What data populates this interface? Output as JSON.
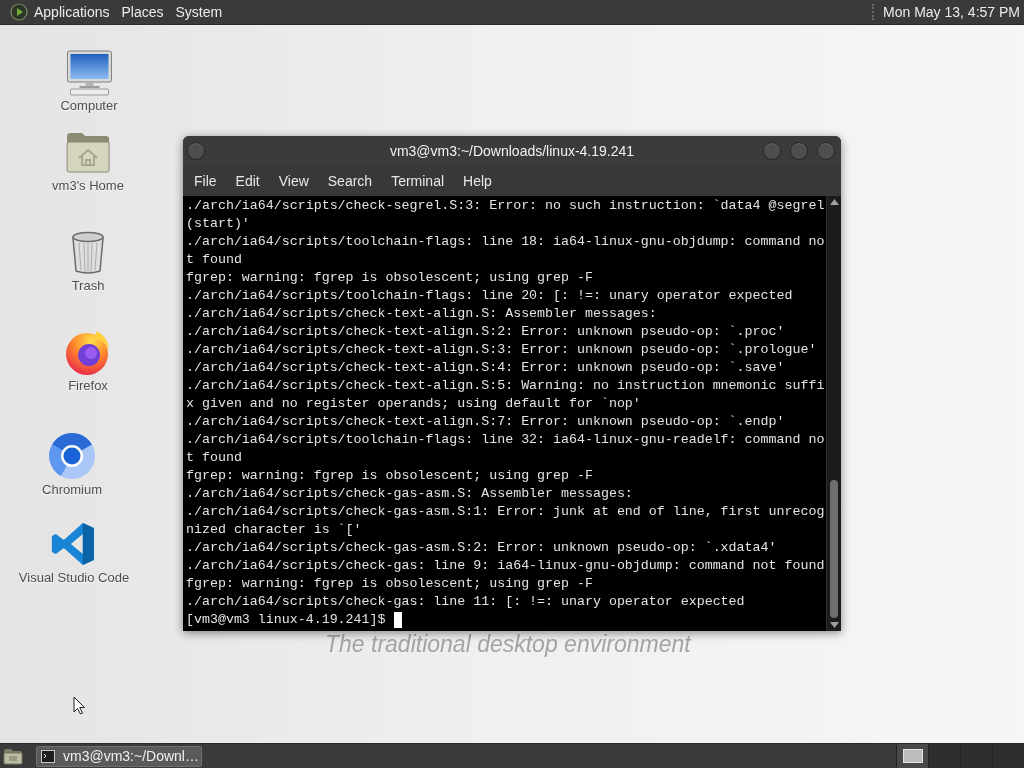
{
  "top_panel": {
    "menus": [
      "Applications",
      "Places",
      "System"
    ],
    "clock": "Mon May 13, 4:57 PM"
  },
  "desktop_icons": [
    {
      "kind": "computer",
      "label": "Computer"
    },
    {
      "kind": "home-folder",
      "label": "vm3's Home"
    },
    {
      "kind": "trash",
      "label": "Trash"
    },
    {
      "kind": "firefox",
      "label": "Firefox"
    },
    {
      "kind": "chromium",
      "label": "Chromium"
    },
    {
      "kind": "vscode",
      "label": "Visual Studio Code"
    }
  ],
  "terminal": {
    "title": "vm3@vm3:~/Downloads/linux-4.19.241",
    "menus": [
      "File",
      "Edit",
      "View",
      "Search",
      "Terminal",
      "Help"
    ],
    "lines": [
      "./arch/ia64/scripts/check-segrel.S:3: Error: no such instruction: `data4 @segrel",
      "(start)'",
      "./arch/ia64/scripts/toolchain-flags: line 18: ia64-linux-gnu-objdump: command no",
      "t found",
      "fgrep: warning: fgrep is obsolescent; using grep -F",
      "./arch/ia64/scripts/toolchain-flags: line 20: [: !=: unary operator expected",
      "./arch/ia64/scripts/check-text-align.S: Assembler messages:",
      "./arch/ia64/scripts/check-text-align.S:2: Error: unknown pseudo-op: `.proc'",
      "./arch/ia64/scripts/check-text-align.S:3: Error: unknown pseudo-op: `.prologue'",
      "./arch/ia64/scripts/check-text-align.S:4: Error: unknown pseudo-op: `.save'",
      "./arch/ia64/scripts/check-text-align.S:5: Warning: no instruction mnemonic suffi",
      "x given and no register operands; using default for `nop'",
      "./arch/ia64/scripts/check-text-align.S:7: Error: unknown pseudo-op: `.endp'",
      "./arch/ia64/scripts/toolchain-flags: line 32: ia64-linux-gnu-readelf: command no",
      "t found",
      "fgrep: warning: fgrep is obsolescent; using grep -F",
      "./arch/ia64/scripts/check-gas-asm.S: Assembler messages:",
      "./arch/ia64/scripts/check-gas-asm.S:1: Error: junk at end of line, first unrecog",
      "nized character is `['",
      "./arch/ia64/scripts/check-gas-asm.S:2: Error: unknown pseudo-op: `.xdata4'",
      "./arch/ia64/scripts/check-gas: line 9: ia64-linux-gnu-objdump: command not found",
      "fgrep: warning: fgrep is obsolescent; using grep -F",
      "./arch/ia64/scripts/check-gas: line 11: [: !=: unary operator expected"
    ],
    "prompt": "[vm3@vm3 linux-4.19.241]$"
  },
  "wallpaper": {
    "tagline": "The traditional desktop environment"
  },
  "bottom_panel": {
    "tasks": [
      {
        "label": "vm3@vm3:~/Downl…",
        "selected": true
      }
    ],
    "workspaces": [
      {
        "selected": true,
        "has_window": true
      },
      {
        "selected": false,
        "has_window": false
      },
      {
        "selected": false,
        "has_window": false
      },
      {
        "selected": false,
        "has_window": false
      }
    ]
  }
}
